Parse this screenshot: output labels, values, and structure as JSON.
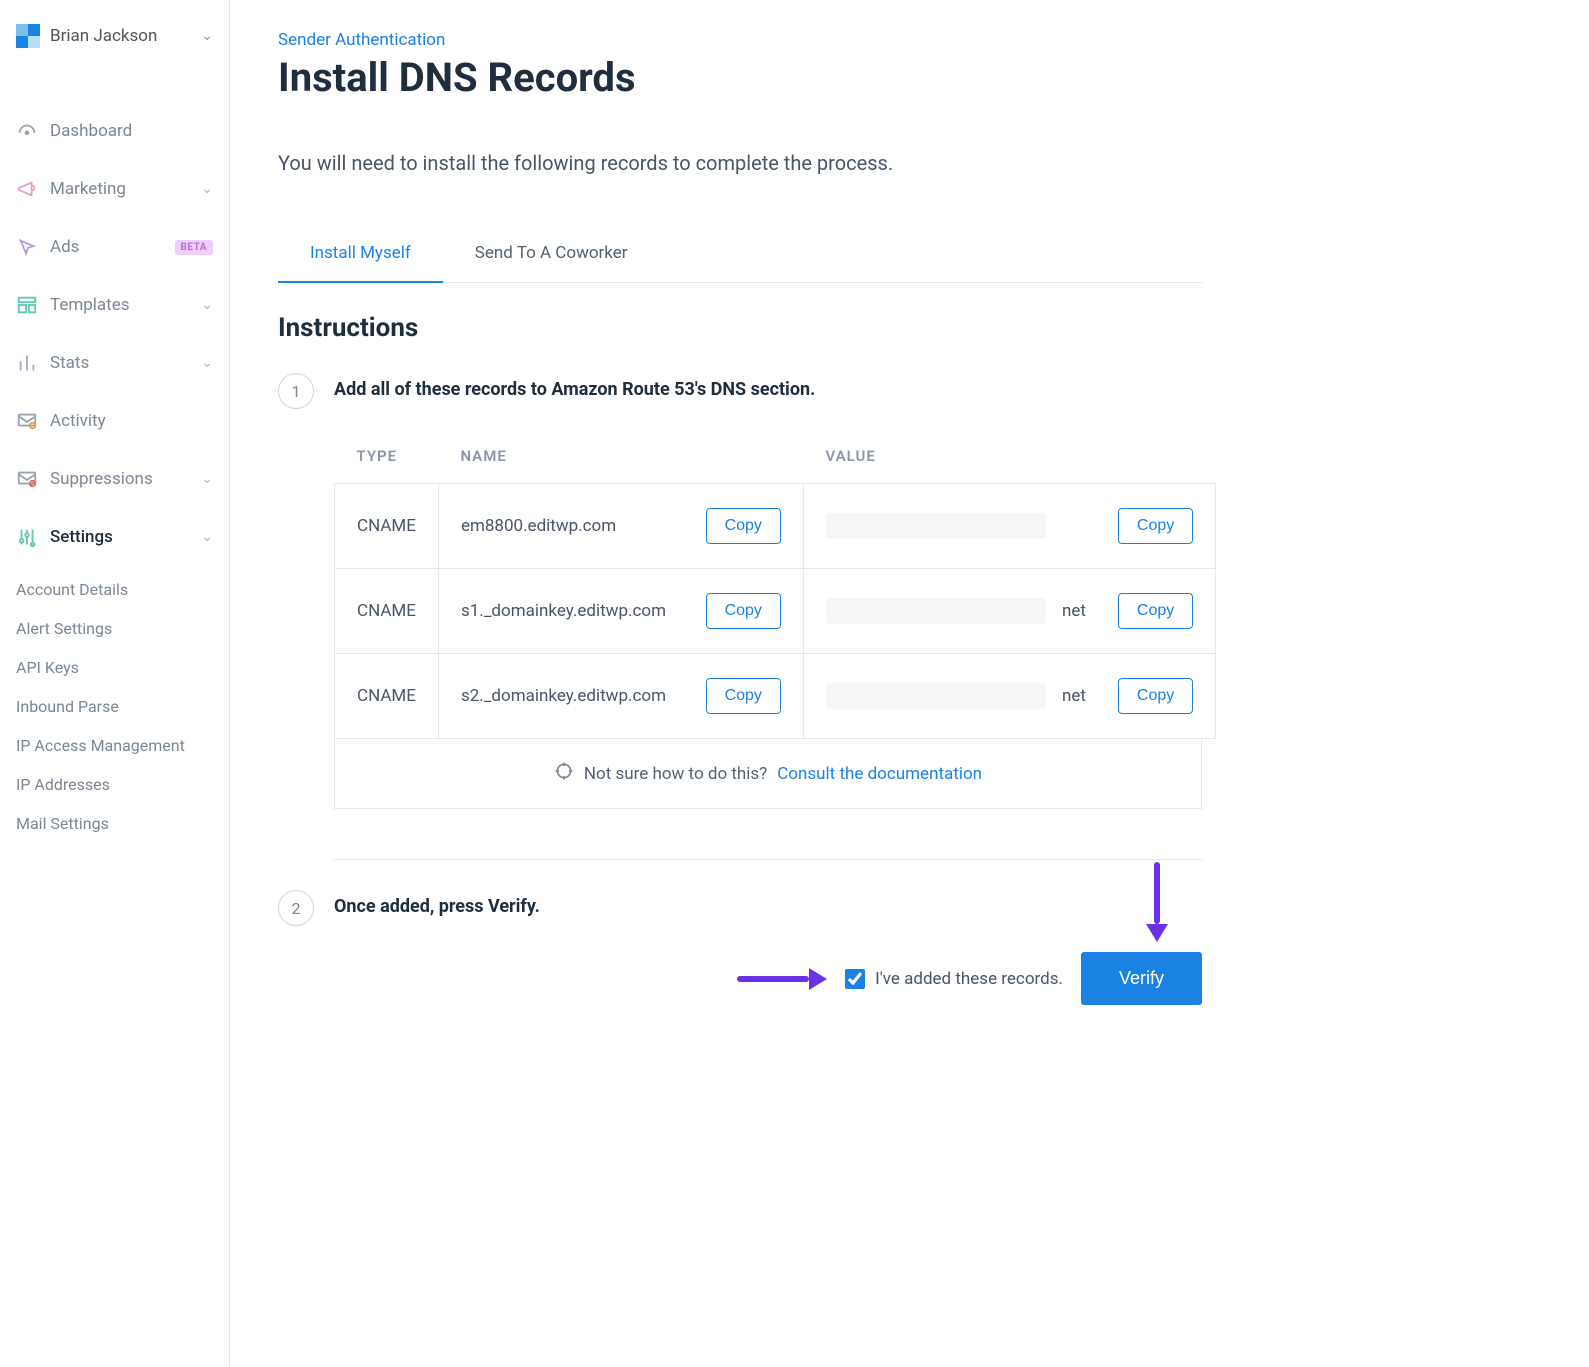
{
  "sidebar": {
    "user_name": "Brian Jackson",
    "items": [
      {
        "label": "Dashboard"
      },
      {
        "label": "Marketing",
        "expandable": true
      },
      {
        "label": "Ads",
        "badge": "BETA"
      },
      {
        "label": "Templates",
        "expandable": true
      },
      {
        "label": "Stats",
        "expandable": true
      },
      {
        "label": "Activity"
      },
      {
        "label": "Suppressions",
        "expandable": true
      },
      {
        "label": "Settings",
        "expandable": true,
        "active": true
      }
    ],
    "settings_subnav": [
      "Account Details",
      "Alert Settings",
      "API Keys",
      "Inbound Parse",
      "IP Access Management",
      "IP Addresses",
      "Mail Settings"
    ]
  },
  "breadcrumb": "Sender Authentication",
  "page_title": "Install DNS Records",
  "page_lead": "You will need to install the following records to complete the process.",
  "tabs": {
    "install_myself": "Install Myself",
    "send_coworker": "Send To A Coworker",
    "active": "install_myself"
  },
  "instructions_heading": "Instructions",
  "step1": {
    "number": "1",
    "title": "Add all of these records to Amazon Route 53's DNS section.",
    "headers": {
      "type": "TYPE",
      "name": "NAME",
      "value": "VALUE"
    },
    "copy_label": "Copy",
    "rows": [
      {
        "type": "CNAME",
        "name": "em8800.editwp.com",
        "value_tail": ""
      },
      {
        "type": "CNAME",
        "name": "s1._domainkey.editwp.com",
        "value_tail": "net"
      },
      {
        "type": "CNAME",
        "name": "s2._domainkey.editwp.com",
        "value_tail": "net"
      }
    ],
    "footer_text": "Not sure how to do this?",
    "footer_link": "Consult the documentation"
  },
  "step2": {
    "number": "2",
    "title": "Once added, press Verify.",
    "checkbox_label": "I've added these records.",
    "checkbox_checked": true,
    "verify_label": "Verify"
  }
}
